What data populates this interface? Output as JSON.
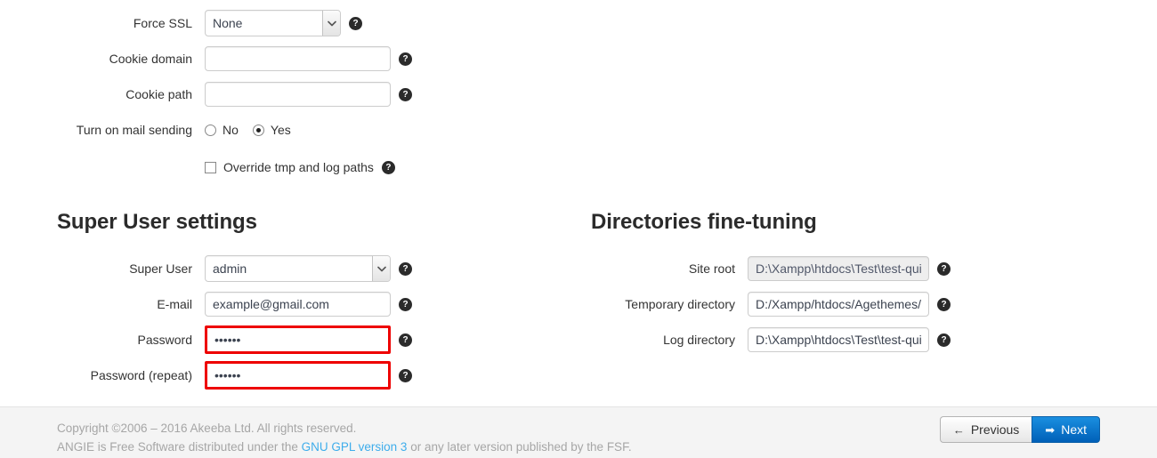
{
  "top_section": {
    "rows": [
      {
        "label": "Force SSL",
        "control": "select",
        "value": "None",
        "help": "?"
      },
      {
        "label": "Cookie domain",
        "control": "text",
        "value": "",
        "placeholder": "",
        "help": "?"
      },
      {
        "label": "Cookie path",
        "control": "text",
        "value": "",
        "placeholder": "",
        "help": "?"
      }
    ],
    "mail": {
      "label": "Turn on mail sending",
      "options": [
        {
          "label": "No",
          "selected": false
        },
        {
          "label": "Yes",
          "selected": true
        }
      ]
    },
    "override": {
      "label": "Override tmp and log paths",
      "checked": false,
      "help": "?"
    }
  },
  "super_user": {
    "title": "Super User settings",
    "rows": [
      {
        "label": "Super User",
        "control": "select",
        "value": "admin",
        "help": "?",
        "error": false
      },
      {
        "label": "E-mail",
        "control": "text",
        "value": "example@gmail.com",
        "help": "?",
        "error": false
      },
      {
        "label": "Password",
        "control": "password",
        "value": "••••••",
        "help": "?",
        "error": true
      },
      {
        "label": "Password (repeat)",
        "control": "password",
        "value": "••••••",
        "help": "?",
        "error": true
      }
    ]
  },
  "directories": {
    "title": "Directories fine-tuning",
    "rows": [
      {
        "label": "Site root",
        "value": "D:\\Xampp\\htdocs\\Test\\test-quic",
        "help": "?",
        "disabled": true
      },
      {
        "label": "Temporary directory",
        "value": "D:/Xampp/htdocs/Agethemes/p",
        "help": "?",
        "disabled": false
      },
      {
        "label": "Log directory",
        "value": "D:\\Xampp\\htdocs\\Test\\test-quic",
        "help": "?",
        "disabled": false
      }
    ]
  },
  "footer": {
    "copyright": "Copyright ©2006 – 2016 Akeeba Ltd. All rights reserved.",
    "license_prefix": "ANGIE is Free Software distributed under the ",
    "license_link": "GNU GPL version 3",
    "license_suffix": " or any later version published by the FSF.",
    "previous_label": "Previous",
    "next_label": "Next",
    "previous_icon": "←",
    "next_icon": "➡"
  },
  "colors": {
    "error_border": "#ee0000",
    "link": "#3eadeb",
    "next_button": "#0a6fc8",
    "footer_bg": "#f4f4f4"
  }
}
